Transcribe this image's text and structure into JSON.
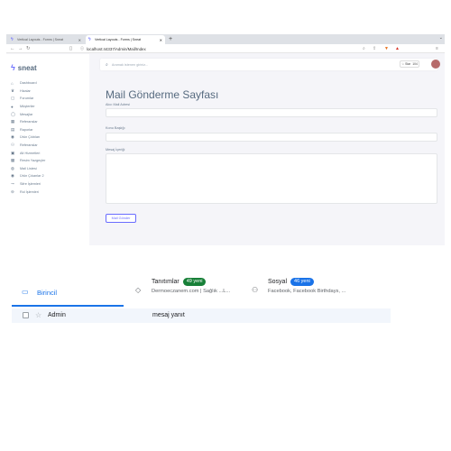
{
  "browser": {
    "tabs": [
      {
        "label": "Vertical Layouts - Forms | Sneat"
      },
      {
        "label": "Vertical Layouts - Forms | Sneat"
      }
    ],
    "new_tab_symbol": "+",
    "url": "localhost:44337/Admin/Mail/Index"
  },
  "sidebar": {
    "brand": "sneat",
    "items": [
      {
        "label": "Dashboard",
        "icon": "home-icon"
      },
      {
        "label": "Hizalar",
        "icon": "crown-icon"
      },
      {
        "label": "Forumlar",
        "icon": "chat-icon"
      },
      {
        "label": "Müşteriler",
        "icon": "user-icon"
      },
      {
        "label": "Mesajlar",
        "icon": "message-icon"
      },
      {
        "label": "Referanslar",
        "icon": "table-icon"
      },
      {
        "label": "Raporlar",
        "icon": "file-icon"
      },
      {
        "label": "Ürün Çıktıları",
        "icon": "eye-icon"
      },
      {
        "label": "Referanslar",
        "icon": "users-icon"
      },
      {
        "label": "Alt Hizmetleri",
        "icon": "box-icon"
      },
      {
        "label": "Resim Yazgeçler",
        "icon": "image-icon"
      },
      {
        "label": "Mail Listesi",
        "icon": "mail-icon"
      },
      {
        "label": "Ürün Çıkanlar 2",
        "icon": "eye2-icon"
      },
      {
        "label": "Sifre İşlemleri",
        "icon": "key-icon"
      },
      {
        "label": "Rol İşlemleri",
        "icon": "lock-icon"
      }
    ]
  },
  "header": {
    "search_placeholder": "Aramak istenen giriniz..."
  },
  "form": {
    "title": "Mail Gönderme Sayfası",
    "receiver_label": "Alıcı Mail Adresi",
    "subject_label": "Konu Başlığı",
    "message_label": "Mesaj İçeriği",
    "send_label": "Mail Gönder"
  },
  "gmail": {
    "primary_label": "Birincil",
    "promotions": {
      "title": "Tanıtımlar",
      "badge": "49 yeni",
      "subtitle": "Dermoeczanem.com | Sağlık ...L..."
    },
    "social": {
      "title": "Sosyal",
      "badge": "46 yeni",
      "subtitle": "Facebook, Facebook Birthdays, ..."
    },
    "row": {
      "sender": "Admin",
      "subject": "mesaj yanıt"
    }
  },
  "colors": {
    "accent": "#696cff",
    "gmail_blue": "#1a73e8",
    "badge_green": "#188038"
  }
}
